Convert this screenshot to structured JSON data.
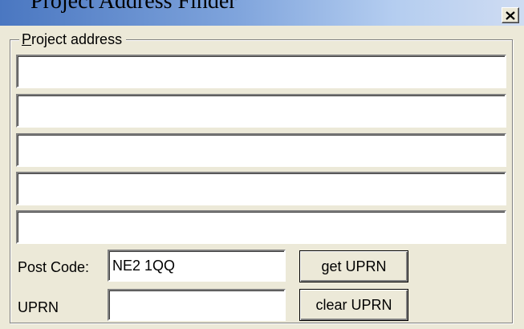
{
  "window": {
    "title": "Project Address Finder",
    "close_icon": "close-icon"
  },
  "project_address": {
    "legend": "Project address",
    "legend_mnemonic": "P",
    "legend_rest": "roject address",
    "lines": [
      "",
      "",
      "",
      "",
      ""
    ]
  },
  "postcode": {
    "label": "Post Code:",
    "value": "NE2 1QQ"
  },
  "uprn": {
    "label": "UPRN",
    "value": ""
  },
  "buttons": {
    "get_uprn": "get UPRN",
    "clear_uprn": "clear UPRN"
  }
}
